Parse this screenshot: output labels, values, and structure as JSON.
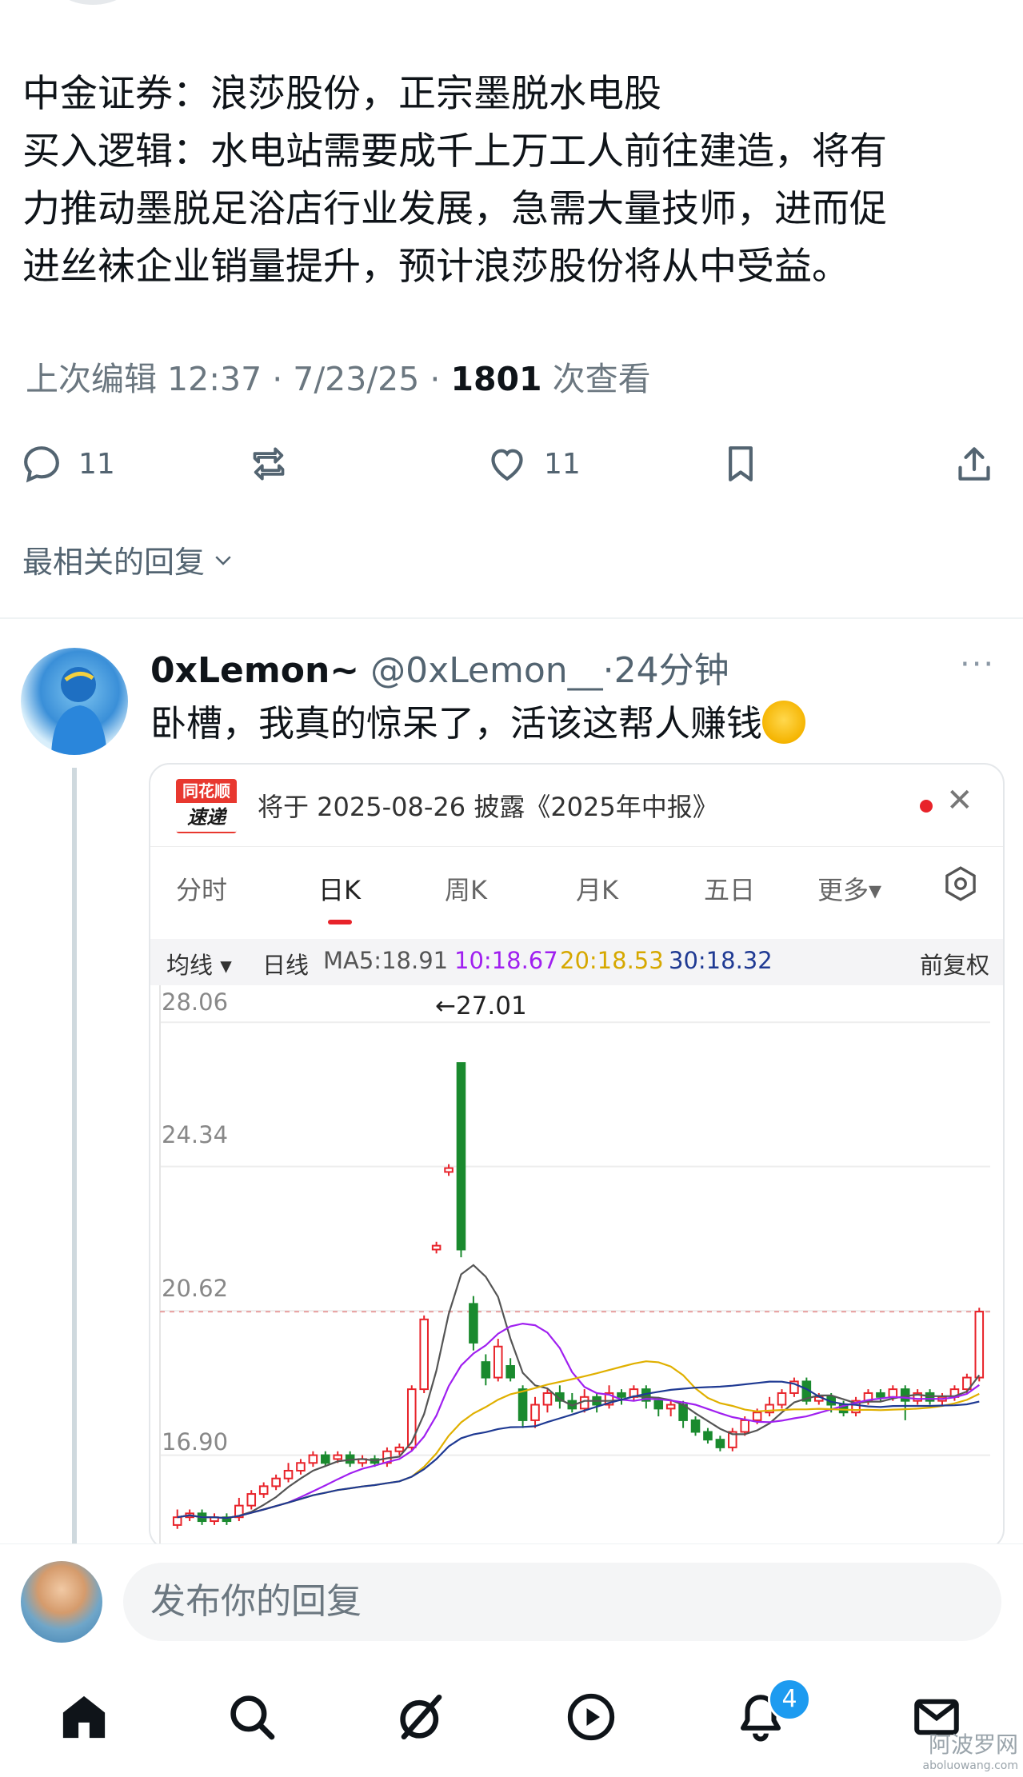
{
  "post": {
    "lines": [
      "中金证券：浪莎股份，正宗墨脱水电股",
      "买入逻辑：水电站需要成千上万工人前往建造，将有",
      "力推动墨脱足浴店行业发展，急需大量技师，进而促",
      "进丝袜企业销量提升，预计浪莎股份将从中受益。"
    ],
    "meta_prefix": "上次编辑 12:37 · 7/23/25 · ",
    "views_count": "1801",
    "views_suffix": " 次查看"
  },
  "actions": {
    "reply_count": "11",
    "like_count": "11"
  },
  "replies_sort_label": "最相关的回复",
  "reply": {
    "name": "0xLemon~",
    "handle": "@0xLemon__",
    "time": "·24分钟",
    "more": "···",
    "text": "卧槽，我真的惊呆了，活该这帮人赚钱"
  },
  "card": {
    "logo_top": "同花顺",
    "logo_bottom": "速递",
    "notice": "将于 2025-08-26 披露《2025年中报》",
    "tabs": [
      "分时",
      "日K",
      "周K",
      "月K",
      "五日",
      "更多▾"
    ],
    "active_tab": "日K",
    "ma": {
      "selector": "均线 ▾",
      "period": "日线",
      "ma5": "MA5:18.91",
      "ma10": "10:18.67",
      "ma20": "20:18.53",
      "ma30": "30:18.32",
      "adjust": "前复权"
    },
    "colors": {
      "up": "#e8232a",
      "down": "#1a8a2e",
      "ma5": "#555555",
      "ma10": "#a020f0",
      "ma20": "#e0b000",
      "ma30": "#1f3a93"
    }
  },
  "chart_data": {
    "type": "candlestick",
    "ytick_labels": [
      "28.06",
      "24.34",
      "20.62",
      "16.90"
    ],
    "annotation": "←27.01",
    "peak_value": 27.01,
    "ylim": [
      14.5,
      28.6
    ],
    "candles": [
      {
        "o": 15.1,
        "c": 15.3,
        "h": 15.5,
        "l": 15.0
      },
      {
        "o": 15.3,
        "c": 15.4,
        "h": 15.5,
        "l": 15.2
      },
      {
        "o": 15.4,
        "c": 15.2,
        "h": 15.5,
        "l": 15.1
      },
      {
        "o": 15.2,
        "c": 15.3,
        "h": 15.4,
        "l": 15.1
      },
      {
        "o": 15.3,
        "c": 15.2,
        "h": 15.4,
        "l": 15.1
      },
      {
        "o": 15.3,
        "c": 15.6,
        "h": 15.8,
        "l": 15.2
      },
      {
        "o": 15.6,
        "c": 15.9,
        "h": 16.0,
        "l": 15.5
      },
      {
        "o": 15.9,
        "c": 16.1,
        "h": 16.2,
        "l": 15.8
      },
      {
        "o": 16.1,
        "c": 16.3,
        "h": 16.4,
        "l": 16.0
      },
      {
        "o": 16.3,
        "c": 16.5,
        "h": 16.7,
        "l": 16.2
      },
      {
        "o": 16.5,
        "c": 16.7,
        "h": 16.8,
        "l": 16.4
      },
      {
        "o": 16.7,
        "c": 16.9,
        "h": 17.0,
        "l": 16.6
      },
      {
        "o": 16.9,
        "c": 16.7,
        "h": 17.0,
        "l": 16.6
      },
      {
        "o": 16.8,
        "c": 16.9,
        "h": 17.0,
        "l": 16.7
      },
      {
        "o": 16.9,
        "c": 16.7,
        "h": 17.0,
        "l": 16.6
      },
      {
        "o": 16.7,
        "c": 16.8,
        "h": 16.9,
        "l": 16.6
      },
      {
        "o": 16.8,
        "c": 16.7,
        "h": 16.9,
        "l": 16.6
      },
      {
        "o": 16.7,
        "c": 17.0,
        "h": 17.1,
        "l": 16.6
      },
      {
        "o": 17.0,
        "c": 17.1,
        "h": 17.2,
        "l": 16.9
      },
      {
        "o": 17.1,
        "c": 18.6,
        "h": 18.7,
        "l": 17.0
      },
      {
        "o": 18.6,
        "c": 20.4,
        "h": 20.5,
        "l": 18.5
      },
      {
        "o": 22.2,
        "c": 22.3,
        "h": 22.4,
        "l": 22.1
      },
      {
        "o": 24.2,
        "c": 24.3,
        "h": 24.4,
        "l": 24.1
      },
      {
        "o": 27.01,
        "c": 22.2,
        "h": 27.01,
        "l": 22.0
      },
      {
        "o": 20.8,
        "c": 19.8,
        "h": 21.0,
        "l": 19.6
      },
      {
        "o": 19.3,
        "c": 18.9,
        "h": 19.5,
        "l": 18.7
      },
      {
        "o": 18.9,
        "c": 19.7,
        "h": 19.9,
        "l": 18.8
      },
      {
        "o": 19.2,
        "c": 18.9,
        "h": 19.4,
        "l": 18.8
      },
      {
        "o": 18.6,
        "c": 17.8,
        "h": 18.7,
        "l": 17.6
      },
      {
        "o": 17.8,
        "c": 18.2,
        "h": 18.4,
        "l": 17.6
      },
      {
        "o": 18.2,
        "c": 18.5,
        "h": 18.6,
        "l": 18.0
      },
      {
        "o": 18.5,
        "c": 18.3,
        "h": 18.7,
        "l": 18.1
      },
      {
        "o": 18.3,
        "c": 18.1,
        "h": 18.5,
        "l": 18.0
      },
      {
        "o": 18.1,
        "c": 18.4,
        "h": 18.6,
        "l": 18.0
      },
      {
        "o": 18.4,
        "c": 18.2,
        "h": 18.5,
        "l": 18.0
      },
      {
        "o": 18.2,
        "c": 18.5,
        "h": 18.7,
        "l": 18.1
      },
      {
        "o": 18.5,
        "c": 18.4,
        "h": 18.6,
        "l": 18.2
      },
      {
        "o": 18.4,
        "c": 18.6,
        "h": 18.7,
        "l": 18.3
      },
      {
        "o": 18.6,
        "c": 18.3,
        "h": 18.7,
        "l": 18.1
      },
      {
        "o": 18.3,
        "c": 18.1,
        "h": 18.4,
        "l": 17.9
      },
      {
        "o": 18.1,
        "c": 18.2,
        "h": 18.3,
        "l": 17.9
      },
      {
        "o": 18.2,
        "c": 17.8,
        "h": 18.3,
        "l": 17.6
      },
      {
        "o": 17.8,
        "c": 17.5,
        "h": 17.9,
        "l": 17.4
      },
      {
        "o": 17.5,
        "c": 17.3,
        "h": 17.6,
        "l": 17.2
      },
      {
        "o": 17.3,
        "c": 17.1,
        "h": 17.4,
        "l": 17.0
      },
      {
        "o": 17.1,
        "c": 17.5,
        "h": 17.6,
        "l": 17.0
      },
      {
        "o": 17.5,
        "c": 17.8,
        "h": 17.9,
        "l": 17.4
      },
      {
        "o": 17.8,
        "c": 18.0,
        "h": 18.1,
        "l": 17.7
      },
      {
        "o": 18.0,
        "c": 18.2,
        "h": 18.4,
        "l": 17.9
      },
      {
        "o": 18.2,
        "c": 18.5,
        "h": 18.6,
        "l": 18.1
      },
      {
        "o": 18.5,
        "c": 18.8,
        "h": 18.9,
        "l": 18.4
      },
      {
        "o": 18.8,
        "c": 18.3,
        "h": 18.9,
        "l": 18.2
      },
      {
        "o": 18.3,
        "c": 18.4,
        "h": 18.5,
        "l": 18.2
      },
      {
        "o": 18.4,
        "c": 18.2,
        "h": 18.5,
        "l": 18.0
      },
      {
        "o": 18.2,
        "c": 18.0,
        "h": 18.3,
        "l": 17.9
      },
      {
        "o": 18.0,
        "c": 18.3,
        "h": 18.4,
        "l": 17.9
      },
      {
        "o": 18.3,
        "c": 18.5,
        "h": 18.6,
        "l": 18.2
      },
      {
        "o": 18.5,
        "c": 18.4,
        "h": 18.6,
        "l": 18.3
      },
      {
        "o": 18.4,
        "c": 18.6,
        "h": 18.7,
        "l": 18.3
      },
      {
        "o": 18.6,
        "c": 18.3,
        "h": 18.7,
        "l": 17.8
      },
      {
        "o": 18.3,
        "c": 18.5,
        "h": 18.6,
        "l": 18.2
      },
      {
        "o": 18.5,
        "c": 18.3,
        "h": 18.6,
        "l": 18.2
      },
      {
        "o": 18.3,
        "c": 18.4,
        "h": 18.5,
        "l": 18.2
      },
      {
        "o": 18.4,
        "c": 18.6,
        "h": 18.7,
        "l": 18.3
      },
      {
        "o": 18.6,
        "c": 18.9,
        "h": 19.0,
        "l": 18.5
      },
      {
        "o": 18.9,
        "c": 20.6,
        "h": 20.7,
        "l": 18.8
      }
    ]
  },
  "composer": {
    "placeholder": "发布你的回复"
  },
  "notifications": {
    "badge": "4"
  },
  "watermark": {
    "line1": "阿波罗网",
    "line2": "aboluowang.com"
  }
}
